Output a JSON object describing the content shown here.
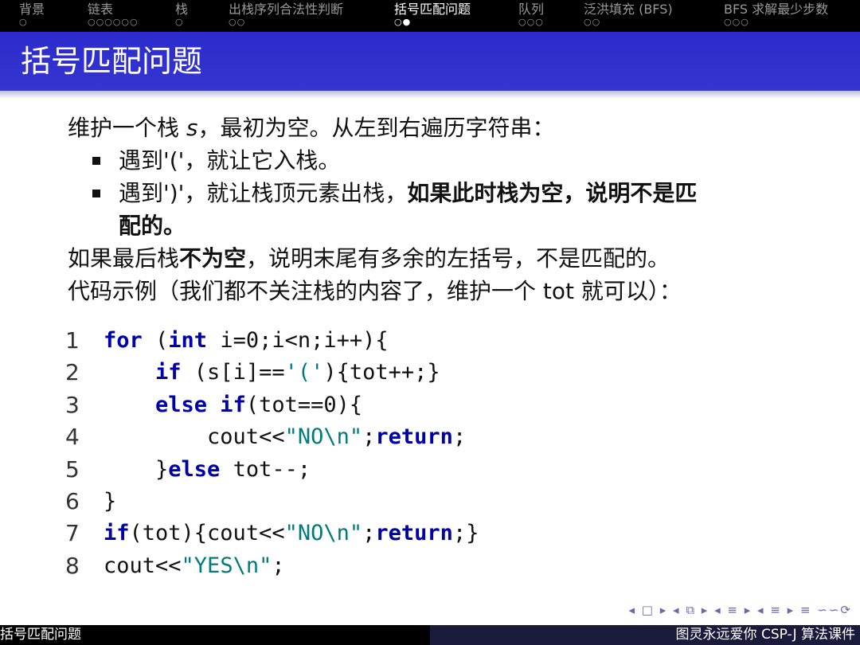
{
  "nav": [
    {
      "label": "背景",
      "dots": "○"
    },
    {
      "label": "链表",
      "dots": "○○○○○○"
    },
    {
      "label": "栈",
      "dots": "○"
    },
    {
      "label": "出栈序列合法性判断",
      "dots": "○○"
    },
    {
      "label": "括号匹配问题",
      "dots": "○●"
    },
    {
      "label": "队列",
      "dots": "○○○"
    },
    {
      "label": "泛洪填充 (BFS)",
      "dots": "○○"
    },
    {
      "label": "BFS 求解最少步数",
      "dots": "○○○"
    }
  ],
  "title": "括号匹配问题",
  "content": {
    "l1a": "维护一个栈 ",
    "l1var": "s",
    "l1b": "，最初为空。从左到右遍历字符串：",
    "b1": "遇到'('，就让它入栈。",
    "b2a": "遇到')'，就让栈顶元素出栈，",
    "b2b": "如果此时栈为空，说明不是匹",
    "b2c": "配的。",
    "l4a": "如果最后栈",
    "l4b": "不为空",
    "l4c": "，说明末尾有多余的左括号，不是匹配的。",
    "l5": "代码示例（我们都不关注栈的内容了，维护一个 tot 就可以）："
  },
  "code": [
    {
      "n": "1",
      "t": [
        {
          "c": "kw",
          "s": "for"
        },
        {
          "c": "tx",
          "s": " ("
        },
        {
          "c": "kw",
          "s": "int"
        },
        {
          "c": "tx",
          "s": " i=0;i<n;i++){"
        }
      ]
    },
    {
      "n": "2",
      "t": [
        {
          "c": "tx",
          "s": "    "
        },
        {
          "c": "kw",
          "s": "if"
        },
        {
          "c": "tx",
          "s": " (s[i]=="
        },
        {
          "c": "str",
          "s": "'('"
        },
        {
          "c": "tx",
          "s": "){tot++;}"
        }
      ]
    },
    {
      "n": "3",
      "t": [
        {
          "c": "tx",
          "s": "    "
        },
        {
          "c": "kw",
          "s": "else if"
        },
        {
          "c": "tx",
          "s": "(tot==0){"
        }
      ]
    },
    {
      "n": "4",
      "t": [
        {
          "c": "tx",
          "s": "        cout<<"
        },
        {
          "c": "str",
          "s": "\"NO\\n\""
        },
        {
          "c": "tx",
          "s": ";"
        },
        {
          "c": "kw",
          "s": "return"
        },
        {
          "c": "tx",
          "s": ";"
        }
      ]
    },
    {
      "n": "5",
      "t": [
        {
          "c": "tx",
          "s": "    }"
        },
        {
          "c": "kw",
          "s": "else"
        },
        {
          "c": "tx",
          "s": " tot--;"
        }
      ]
    },
    {
      "n": "6",
      "t": [
        {
          "c": "tx",
          "s": "}"
        }
      ]
    },
    {
      "n": "7",
      "t": [
        {
          "c": "kw",
          "s": "if"
        },
        {
          "c": "tx",
          "s": "(tot){cout<<"
        },
        {
          "c": "str",
          "s": "\"NO\\n\""
        },
        {
          "c": "tx",
          "s": ";"
        },
        {
          "c": "kw",
          "s": "return"
        },
        {
          "c": "tx",
          "s": ";}"
        }
      ]
    },
    {
      "n": "8",
      "t": [
        {
          "c": "tx",
          "s": "cout<<"
        },
        {
          "c": "str",
          "s": "\"YES\\n\""
        },
        {
          "c": "tx",
          "s": ";"
        }
      ]
    }
  ],
  "beamer_nav": "◂ □ ▸ ◂ ⧉ ▸ ◂ ≡ ▸ ◂ ≡ ▸  ≡  ∽∽⟳",
  "footer": {
    "left": "括号匹配问题",
    "right": "图灵永远爱你 CSP-J 算法课件"
  }
}
